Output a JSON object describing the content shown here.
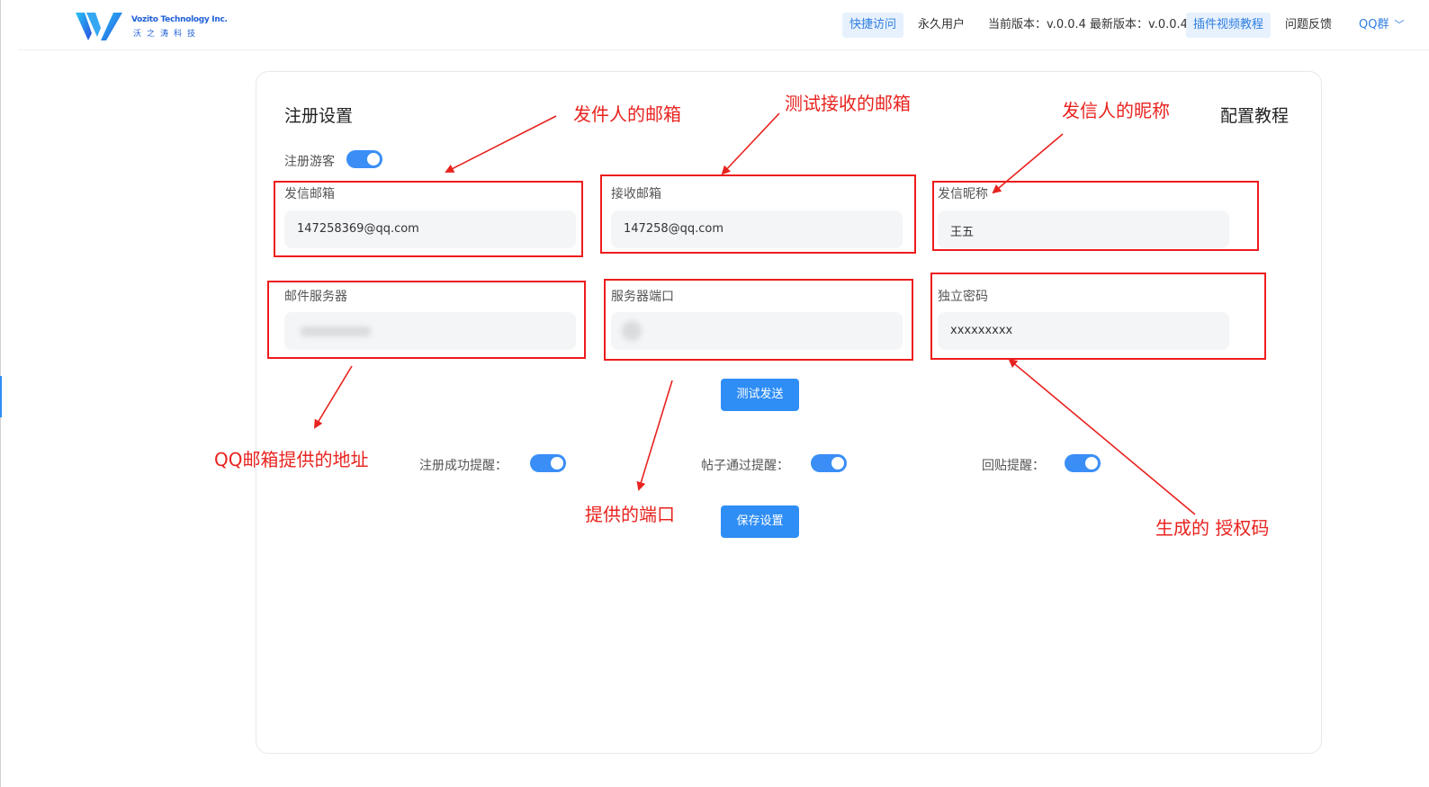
{
  "header": {
    "logo_en": "Vozito Technology Inc.",
    "logo_cn": "沃之涛科技",
    "nav": {
      "quick_access": "快捷访问",
      "user_type": "永久用户",
      "version": "当前版本：v.0.0.4 最新版本：v.0.0.4",
      "video_tutorial": "插件视频教程",
      "feedback": "问题反馈",
      "qq_group": "QQ群"
    }
  },
  "card": {
    "title": "注册设置",
    "config_tutorial": "配置教程",
    "guest_register": {
      "label": "注册游客",
      "on": true
    },
    "fields": {
      "sender_email": {
        "label": "发信邮箱",
        "value": "147258369@qq.com"
      },
      "receiver_email": {
        "label": "接收邮箱",
        "value": "147258@qq.com"
      },
      "sender_nickname": {
        "label": "发信昵称",
        "value": "王五"
      },
      "mail_server": {
        "label": "邮件服务器",
        "value": ""
      },
      "server_port": {
        "label": "服务器端口",
        "value": ""
      },
      "app_password": {
        "label": "独立密码",
        "value": "xxxxxxxxx"
      }
    },
    "test_send": "测试发送",
    "toggles": {
      "register_success": {
        "label": "注册成功提醒：",
        "on": true
      },
      "post_approved": {
        "label": "帖子通过提醒：",
        "on": true
      },
      "reply": {
        "label": "回贴提醒：",
        "on": true
      }
    },
    "save": "保存设置"
  },
  "annotations": {
    "sender_email": "发件人的邮箱",
    "test_receive": "测试接收的邮箱",
    "sender_nickname": "发信人的昵称",
    "qq_address": "QQ邮箱提供的地址",
    "port": "提供的端口",
    "auth_code": "生成的 授权码"
  },
  "colors": {
    "accent": "#2f8ef6",
    "annotation": "#ee1c1c"
  }
}
